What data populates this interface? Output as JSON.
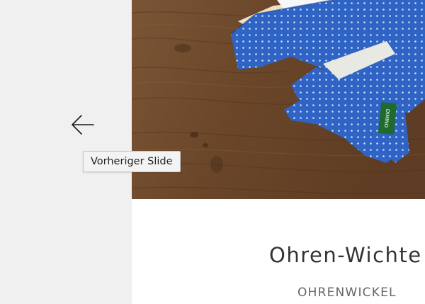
{
  "slider": {
    "prev_icon": "arrow-left-icon",
    "tooltip": "Vorheriger Slide"
  },
  "product": {
    "title": "Ohren-Wichte",
    "category": "OHRENWICKEL",
    "label_text": "DIMINO"
  },
  "colors": {
    "left_panel": "#f0f0f1",
    "wood": "#6e4a2d",
    "fabric_blue": "#2f63c4",
    "label_green": "#1f6a2c",
    "title_text": "#333333",
    "category_text": "#666666"
  }
}
